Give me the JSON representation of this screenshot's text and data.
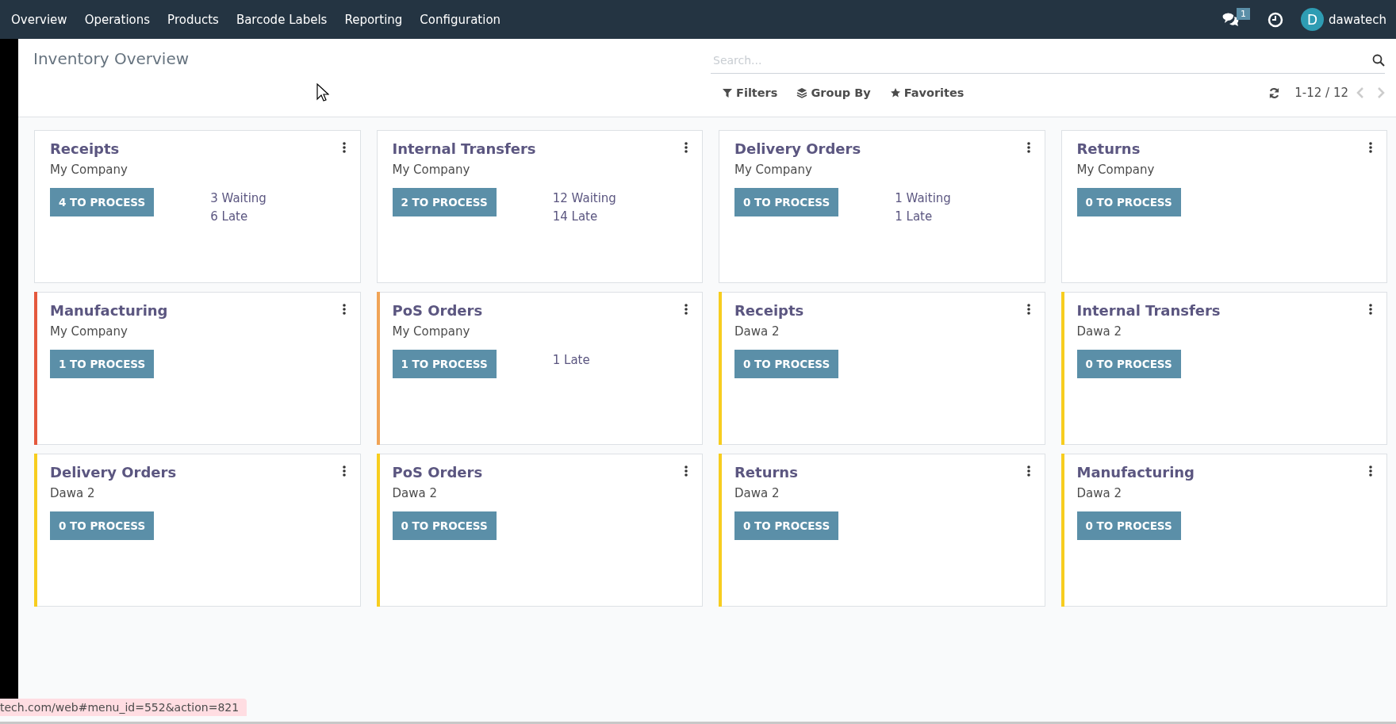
{
  "menu": [
    "Overview",
    "Operations",
    "Products",
    "Barcode Labels",
    "Reporting",
    "Configuration"
  ],
  "systray": {
    "messages_badge": "1",
    "avatar_letter": "D",
    "user": "dawatech"
  },
  "title": "Inventory Overview",
  "search": {
    "placeholder": "Search..."
  },
  "filters": [
    "Filters",
    "Group By",
    "Favorites"
  ],
  "pager": "1-12 / 12",
  "cards": [
    {
      "title": "Receipts",
      "company": "My Company",
      "button": "4 TO PROCESS",
      "stats": [
        "3 Waiting",
        "6 Late"
      ]
    },
    {
      "title": "Internal Transfers",
      "company": "My Company",
      "button": "2 TO PROCESS",
      "stats": [
        "12 Waiting",
        "14 Late"
      ]
    },
    {
      "title": "Delivery Orders",
      "company": "My Company",
      "button": "0 TO PROCESS",
      "stats": [
        "1 Waiting",
        "1 Late"
      ]
    },
    {
      "title": "Returns",
      "company": "My Company",
      "button": "0 TO PROCESS"
    },
    {
      "title": "Manufacturing",
      "company": "My Company",
      "button": "1 TO PROCESS",
      "color": "#e4583d"
    },
    {
      "title": "PoS Orders",
      "company": "My Company",
      "button": "1 TO PROCESS",
      "stats": [
        "1 Late"
      ],
      "color": "#f0a457"
    },
    {
      "title": "Receipts",
      "company": "Dawa 2",
      "button": "0 TO PROCESS",
      "color": "#f7cd1f"
    },
    {
      "title": "Internal Transfers",
      "company": "Dawa 2",
      "button": "0 TO PROCESS",
      "color": "#f7cd1f"
    },
    {
      "title": "Delivery Orders",
      "company": "Dawa 2",
      "button": "0 TO PROCESS",
      "color": "#f7cd1f"
    },
    {
      "title": "PoS Orders",
      "company": "Dawa 2",
      "button": "0 TO PROCESS",
      "color": "#f7cd1f"
    },
    {
      "title": "Returns",
      "company": "Dawa 2",
      "button": "0 TO PROCESS",
      "color": "#f7cd1f"
    },
    {
      "title": "Manufacturing",
      "company": "Dawa 2",
      "button": "0 TO PROCESS",
      "color": "#f7cd1f"
    }
  ],
  "status_url": "tech.com/web#menu_id=552&action=821"
}
